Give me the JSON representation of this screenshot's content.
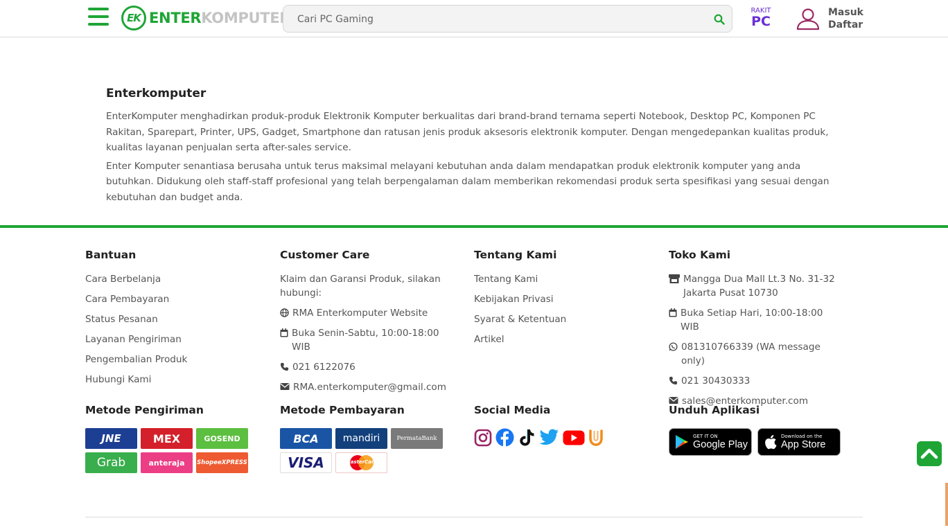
{
  "header": {
    "logo_main": "ENTER",
    "logo_light": "KOMPUTER",
    "logo_mark": "EK",
    "search_placeholder": "Cari PC Gaming",
    "rakit_small": "RAKIT",
    "rakit_big": "PC",
    "login": "Masuk",
    "register": "Daftar"
  },
  "about": {
    "title": "Enterkomputer",
    "paragraph1": "EnterKomputer menghadirkan produk-produk Elektronik Komputer berkualitas dari brand-brand ternama seperti Notebook, Desktop PC, Komponen PC Rakitan, Sparepart, Printer, UPS, Gadget, Smartphone dan ratusan jenis produk aksesoris elektronik komputer. Dengan mengedepankan kualitas produk, kualitas layanan penjualan serta after-sales service.",
    "paragraph2": "Enter Komputer senantiasa berusaha untuk terus maksimal melayani kebutuhan anda dalam mendapatkan produk elektronik komputer yang anda butuhkan. Didukung oleh staff-staff profesional yang telah berpengalaman dalam memberikan rekomendasi produk serta spesifikasi yang sesuai dengan kebutuhan dan budget anda."
  },
  "bantuan": {
    "title": "Bantuan",
    "items": [
      "Cara Berbelanja",
      "Cara Pembayaran",
      "Status Pesanan",
      "Layanan Pengiriman",
      "Pengembalian Produk",
      "Hubungi Kami"
    ]
  },
  "customer_care": {
    "title": "Customer Care",
    "intro": "Klaim dan Garansi Produk, silakan hubungi:",
    "website": "RMA Enterkomputer Website",
    "hours": "Buka Senin-Sabtu, 10:00-18:00 WIB",
    "phone": "021 6122076",
    "email": "RMA.enterkomputer@gmail.com"
  },
  "tentang": {
    "title": "Tentang Kami",
    "items": [
      "Tentang Kami",
      "Kebijakan Privasi",
      "Syarat & Ketentuan",
      "Artikel"
    ]
  },
  "toko": {
    "title": "Toko Kami",
    "address": "Mangga Dua Mall Lt.3 No. 31-32 Jakarta Pusat 10730",
    "hours": "Buka Setiap Hari, 10:00-18:00 WIB",
    "whatsapp": "081310766339 (WA message only)",
    "phone": "021 30430333",
    "email": "sales@enterkomputer.com"
  },
  "shipping": {
    "title": "Metode Pengiriman",
    "logos": [
      "JNE",
      "MEX",
      "GOSEND",
      "Grab",
      "anteraja",
      "ShopeeXPRESS"
    ],
    "colors": [
      "#1d3f93",
      "#d4202a",
      "#5cbf3f",
      "#39ae4c",
      "#ec3e85",
      "#ee5a32"
    ]
  },
  "payment": {
    "title": "Metode Pembayaran",
    "logos": [
      "BCA",
      "mandiri",
      "PermataBank",
      "VISA",
      "MasterCard"
    ]
  },
  "social": {
    "title": "Social Media",
    "icons": [
      "instagram-icon",
      "facebook-icon",
      "tiktok-icon",
      "twitter-icon",
      "youtube-icon",
      "u-icon"
    ]
  },
  "apps": {
    "title": "Unduh Aplikasi",
    "google_small": "GET IT ON",
    "google_big": "Google Play",
    "apple_small": "Download on the",
    "apple_big": "App Store"
  },
  "colors": {
    "brand_green": "#1ea535",
    "rakit_purple": "#6a2fd6"
  }
}
